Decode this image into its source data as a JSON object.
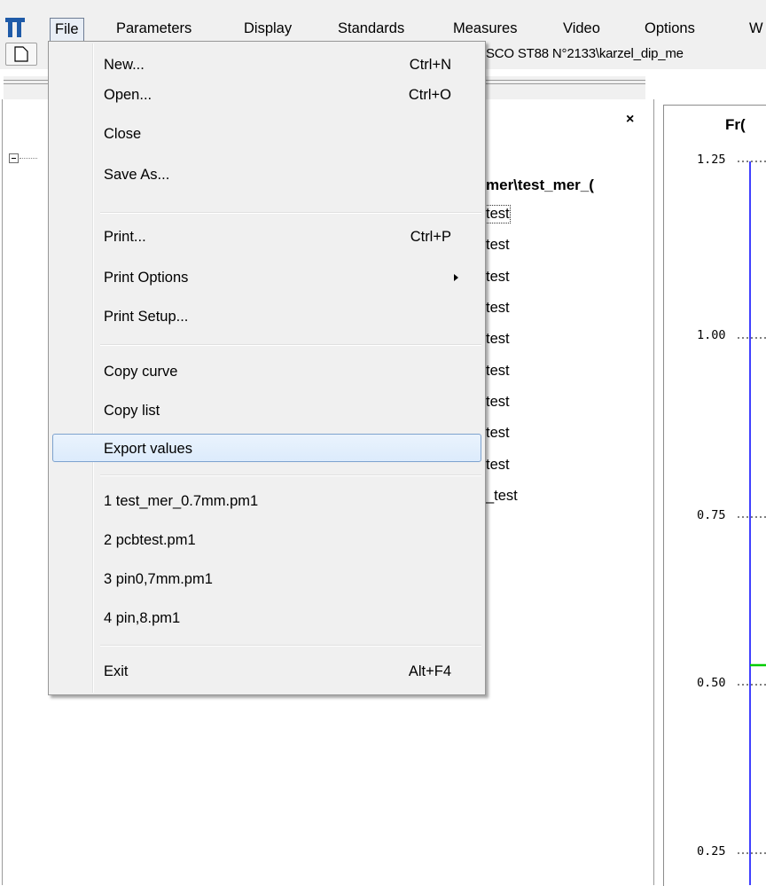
{
  "menubar": {
    "items": [
      "File",
      "Parameters",
      "Display",
      "Standards",
      "Measures",
      "Video",
      "Options",
      "W"
    ]
  },
  "toolbar": {
    "path_text": "SCO ST88 N°2133\\karzel_dip_me"
  },
  "tree": {
    "root_label": "mer\\test_mer_(",
    "leaves": [
      "test",
      "test",
      "test",
      "test",
      "test",
      "test",
      "test",
      "test",
      "test",
      "_test"
    ]
  },
  "chart": {
    "title": "Fr(",
    "y_ticks": [
      "1.25",
      "1.00",
      "0.75",
      "0.50",
      "0.25"
    ],
    "axis_color": "#0000ff",
    "series_color": "#00cc00"
  },
  "file_menu": {
    "new": {
      "label": "New...",
      "shortcut": "Ctrl+N"
    },
    "open": {
      "label": "Open...",
      "shortcut": "Ctrl+O"
    },
    "close": {
      "label": "Close"
    },
    "save_as": {
      "label": "Save As..."
    },
    "print": {
      "label": "Print...",
      "shortcut": "Ctrl+P"
    },
    "print_options": {
      "label": "Print Options"
    },
    "print_setup": {
      "label": "Print Setup..."
    },
    "copy_curve": {
      "label": "Copy curve"
    },
    "copy_list": {
      "label": "Copy list"
    },
    "export_values": {
      "label": "Export values"
    },
    "recent": [
      "1 test_mer_0.7mm.pm1",
      "2 pcbtest.pm1",
      "3 pin0,7mm.pm1",
      "4 pin,8.pm1"
    ],
    "exit": {
      "label": "Exit",
      "shortcut": "Alt+F4"
    }
  }
}
